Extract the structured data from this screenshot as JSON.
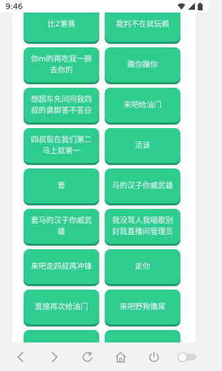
{
  "status_bar": {
    "time": "9:46"
  },
  "buttons": [
    {
      "label": "比2第赛"
    },
    {
      "label": "裁判不在就玩赖"
    },
    {
      "label": "你m的再吃我一脚去你的"
    },
    {
      "label": "踹你踹你"
    },
    {
      "label": "想超车先问问我四叔的臭脚答不答应"
    },
    {
      "label": "来吧给油门"
    },
    {
      "label": "四叔现在我们第二马上就第一"
    },
    {
      "label": "活该"
    },
    {
      "label": "套"
    },
    {
      "label": "马的汉子你威武雄"
    },
    {
      "label": "套马的汉子你威武雄"
    },
    {
      "label": "我没骂人我唱歌别封我直播间管理员"
    },
    {
      "label": "来吧走四叔再冲锋"
    },
    {
      "label": "走你"
    },
    {
      "label": "直接再次给油门"
    },
    {
      "label": "来吧野狗撒尿"
    },
    {
      "label": ""
    },
    {
      "label": ""
    }
  ],
  "nav": {
    "icons": [
      "back-icon",
      "forward-icon",
      "refresh-icon",
      "home-icon",
      "power-icon",
      "toggle-switch"
    ],
    "toggle_on": false
  },
  "colors": {
    "button": "#2ecc8f",
    "button_shadow": "#1f9a6a",
    "background": "#f2f2f2",
    "content": "#ffffff"
  }
}
